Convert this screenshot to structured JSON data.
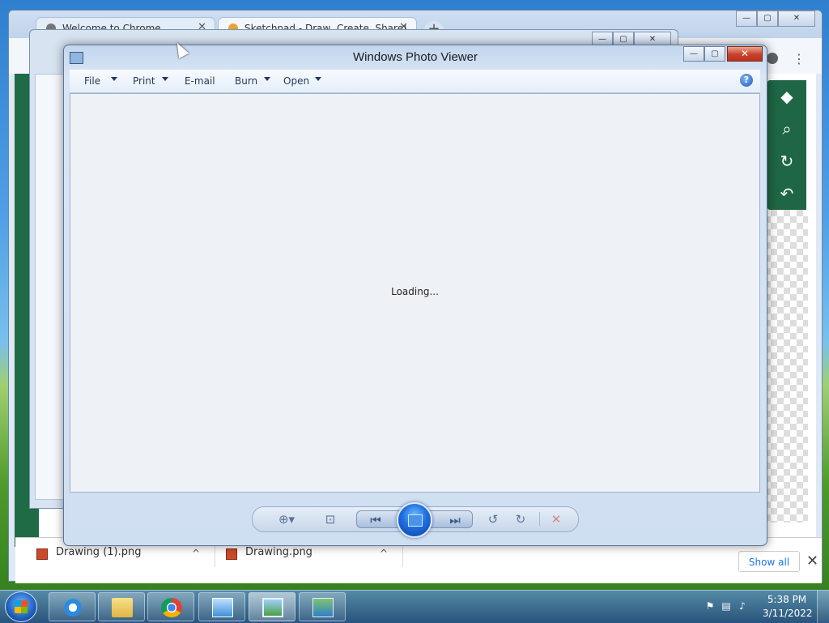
{
  "chrome": {
    "tabs": [
      {
        "label": "Welcome to Chrome",
        "close": "✕"
      },
      {
        "label": "Sketchpad - Draw, Create, Share!",
        "close": "✕"
      }
    ],
    "new_tab": "+",
    "window_controls": {
      "minimize": "—",
      "maximize": "▢",
      "close": "✕"
    },
    "menu_icon": "⋮",
    "sketch_tools": [
      {
        "icon": "layers-icon",
        "glyph": "◆"
      },
      {
        "icon": "search-icon",
        "glyph": "⌕"
      },
      {
        "icon": "history-icon",
        "glyph": "↻"
      },
      {
        "icon": "undo-icon",
        "glyph": "↶"
      }
    ],
    "downloads": {
      "items": [
        {
          "name": "Drawing (1).png",
          "caret": "^"
        },
        {
          "name": "Drawing.png",
          "caret": "^"
        }
      ],
      "show_all": "Show all",
      "close": "✕"
    }
  },
  "photo_viewer": {
    "title": "Windows Photo Viewer",
    "window_controls": {
      "minimize": "—",
      "maximize": "▢",
      "close": "✕"
    },
    "menu": [
      {
        "label": "File",
        "has_dropdown": true
      },
      {
        "label": "Print",
        "has_dropdown": true
      },
      {
        "label": "E-mail",
        "has_dropdown": false
      },
      {
        "label": "Burn",
        "has_dropdown": true
      },
      {
        "label": "Open",
        "has_dropdown": true
      }
    ],
    "help": "?",
    "status_text": "Loading...",
    "controls": {
      "zoom": "⊕▾",
      "actual_size": "⊡",
      "previous": "⏮",
      "next": "⏭",
      "rotate_ccw": "↺",
      "rotate_cw": "↻",
      "delete": "✕"
    }
  },
  "taskbar": {
    "pinned": [
      "internet-explorer",
      "windows-explorer",
      "google-chrome",
      "control-panel",
      "windows-photo-viewer",
      "remote-desktop"
    ],
    "clock": {
      "time": "5:38 PM",
      "date": "3/11/2022"
    },
    "tray_icons": [
      "flag-icon",
      "network-icon",
      "volume-icon"
    ]
  },
  "colors": {
    "sketch_green": "#1e6644",
    "close_red": "#c7412a",
    "slideshow_blue": "#1f6fe0",
    "link_blue": "#1a73e8"
  }
}
